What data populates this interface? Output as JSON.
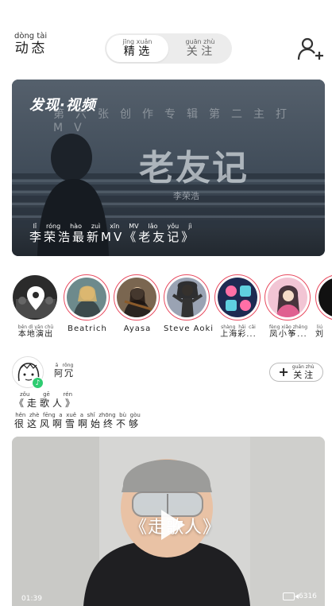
{
  "header": {
    "title": "动态",
    "title_pinyin": "dòng tài",
    "tabs": [
      {
        "label": "精选",
        "pinyin": "jīng xuǎn",
        "active": true
      },
      {
        "label": "关注",
        "pinyin": "guān zhù",
        "active": false
      }
    ],
    "add_user_icon": "add-user-icon"
  },
  "banner": {
    "tag": "发现·视频",
    "overlay_sub": "第六张创作专辑第二主打MV",
    "overlay_big": "老友记",
    "overlay_small": "李荣浩",
    "caption": "李荣浩最新MV《老友记》",
    "caption_pinyin": "lǐ róng hào zuì xīn MV lǎo yǒu jì"
  },
  "artists": [
    {
      "name": "本地演出",
      "pinyin": "běn dì yǎn chū"
    },
    {
      "name": "Beatrich",
      "pinyin": ""
    },
    {
      "name": "Ayasa",
      "pinyin": ""
    },
    {
      "name": "Steve Aoki",
      "pinyin": ""
    },
    {
      "name": "上海彩...",
      "pinyin": "shàng hǎi cǎi"
    },
    {
      "name": "凤小筝...",
      "pinyin": "fèng xiǎo zhēng"
    },
    {
      "name": "刘",
      "pinyin": "liú"
    }
  ],
  "post": {
    "user": "阿冗",
    "user_pinyin": "ā rǒng",
    "follow_label": "关注",
    "follow_pinyin": "guān zhù",
    "song": "《走歌人》",
    "song_pinyin": "zǒu gē rén",
    "lyric": "很这风啊雪啊始终不够",
    "lyric_pinyin": "hěn zhè fēng a xuě a shǐ zhōng bù gòu",
    "video": {
      "title": "《走歌人》",
      "duration": "01:39",
      "views": "6316"
    }
  },
  "colors": {
    "accent": "#e84a5f",
    "segment_bg": "#ececec",
    "badge": "#2ecc71"
  }
}
